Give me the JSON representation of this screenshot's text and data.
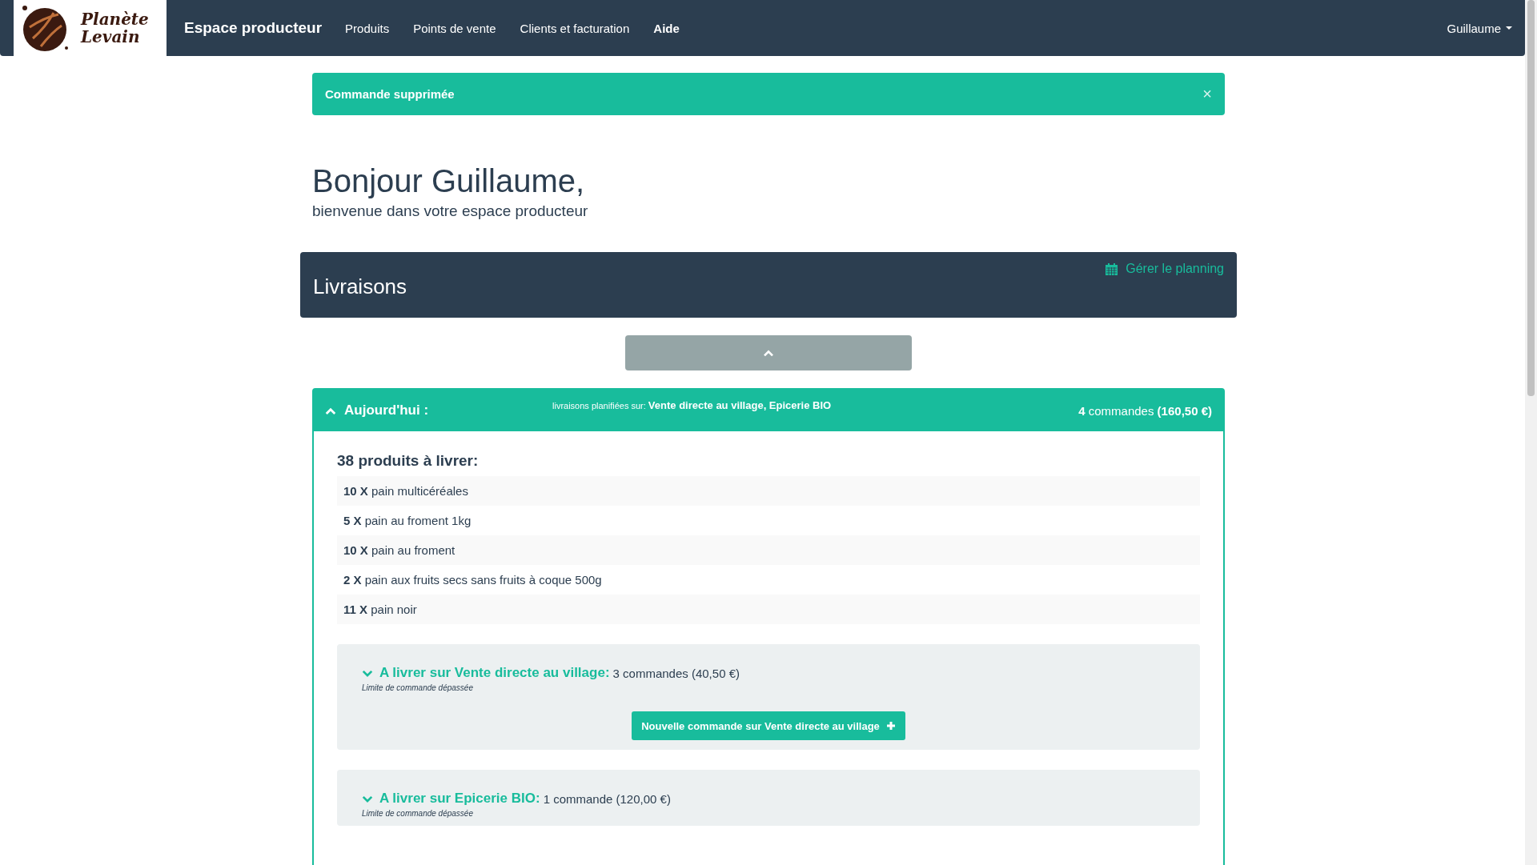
{
  "navbar": {
    "logo_lines": [
      "Planète",
      "Levain"
    ],
    "brand": "Espace producteur",
    "items": [
      {
        "label": "Produits",
        "selected": false
      },
      {
        "label": "Points de vente",
        "selected": false
      },
      {
        "label": "Clients et facturation",
        "selected": false
      },
      {
        "label": "Aide",
        "selected": true
      }
    ],
    "user": "Guillaume"
  },
  "alert": {
    "text": "Commande supprimée",
    "close": "×"
  },
  "greeting": {
    "title": "Bonjour Guillaume,",
    "subtitle": "bienvenue dans votre espace producteur"
  },
  "deliveries": {
    "title": "Livraisons",
    "planning_link": "Gérer le planning"
  },
  "today": {
    "expanded": true,
    "title": "Aujourd'hui :",
    "planned_prefix": "livraisons planifiées sur:",
    "planned_points": "Vente directe au village, Epicerie BIO",
    "count": "4",
    "count_text": "commandes",
    "total": "(160,50 €)",
    "products_title": "38 produits à livrer:",
    "products": [
      {
        "qty": "10 X",
        "name": "pain multicéréales"
      },
      {
        "qty": "5 X",
        "name": "pain au froment 1kg"
      },
      {
        "qty": "10 X",
        "name": "pain au froment"
      },
      {
        "qty": "2 X",
        "name": "pain aux fruits secs sans fruits à coque 500g"
      },
      {
        "qty": "11 X",
        "name": "pain noir"
      }
    ],
    "points": [
      {
        "expanded": false,
        "title": "A livrer sur Vente directe au village:",
        "orders": "3 commandes (40,50 €)",
        "note": "Limite de commande dépassée",
        "button": "Nouvelle commande sur Vente directe au village"
      },
      {
        "expanded": false,
        "title": "A livrer sur Epicerie BIO:",
        "orders": "1 commande (120,00 €)",
        "note": "Limite de commande dépassée"
      }
    ]
  }
}
